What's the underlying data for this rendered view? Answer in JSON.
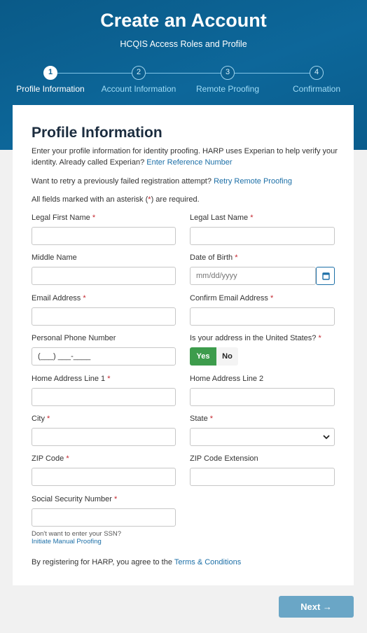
{
  "header": {
    "title": "Create an Account",
    "subtitle": "HCQIS Access Roles and Profile"
  },
  "steps": [
    {
      "number": "1",
      "label": "Profile Information",
      "active": true
    },
    {
      "number": "2",
      "label": "Account Information",
      "active": false
    },
    {
      "number": "3",
      "label": "Remote Proofing",
      "active": false
    },
    {
      "number": "4",
      "label": "Confirmation",
      "active": false
    }
  ],
  "form": {
    "title": "Profile Information",
    "intro_text": "Enter your profile information for identity proofing. HARP uses Experian to help verify your identity. Already called Experian?",
    "intro_link": "Enter Reference Number",
    "retry_text": "Want to retry a previously failed registration attempt?",
    "retry_link": "Retry Remote Proofing",
    "required_pre": "All fields marked with an asterisk (",
    "required_star": "*",
    "required_post": ") are required.",
    "required_marker": "*",
    "fields": {
      "first_name": {
        "label": "Legal First Name",
        "value": ""
      },
      "last_name": {
        "label": "Legal Last Name",
        "value": ""
      },
      "middle_name": {
        "label": "Middle Name",
        "value": ""
      },
      "dob": {
        "label": "Date of Birth",
        "placeholder": "mm/dd/yyyy"
      },
      "email": {
        "label": "Email Address",
        "value": ""
      },
      "confirm_email": {
        "label": "Confirm Email Address",
        "value": ""
      },
      "phone": {
        "label": "Personal Phone Number",
        "mask": "(___) ___-____"
      },
      "us_address": {
        "label": "Is your address in the United States?",
        "yes": "Yes",
        "no": "No",
        "selected": "Yes"
      },
      "address1": {
        "label": "Home Address Line 1",
        "value": ""
      },
      "address2": {
        "label": "Home Address Line 2",
        "value": ""
      },
      "city": {
        "label": "City",
        "value": ""
      },
      "state": {
        "label": "State",
        "value": ""
      },
      "zip": {
        "label": "ZIP Code",
        "value": ""
      },
      "zip_ext": {
        "label": "ZIP Code Extension",
        "value": ""
      },
      "ssn": {
        "label": "Social Security Number",
        "value": ""
      }
    },
    "ssn_help": "Don't want to enter your SSN?",
    "ssn_link": "Initiate Manual Proofing",
    "terms_text": "By registering for HARP, you agree to the",
    "terms_link": "Terms & Conditions"
  },
  "next_button": {
    "label": "Next",
    "arrow": "→"
  },
  "colors": {
    "brand": "#0b5f8f",
    "link": "#1c6fa7",
    "required": "#c4262e",
    "yes_toggle": "#3d9c4c",
    "next_button": "#6aa6c6"
  }
}
